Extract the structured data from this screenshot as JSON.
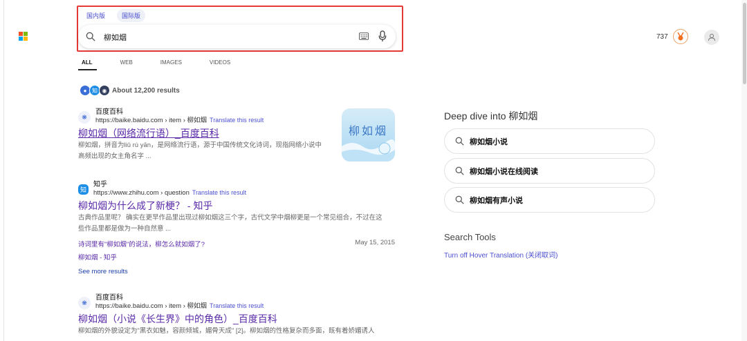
{
  "brand": {
    "logo_colors": [
      "#f25022",
      "#7fba00",
      "#00a4ef",
      "#ffb900"
    ]
  },
  "scope_tabs": [
    {
      "label": "国内版"
    },
    {
      "label": "国际版"
    }
  ],
  "search": {
    "query": "柳如烟"
  },
  "header": {
    "points": "737"
  },
  "nav_tabs": [
    {
      "label": "ALL"
    },
    {
      "label": "WEB"
    },
    {
      "label": "IMAGES"
    },
    {
      "label": "VIDEOS"
    }
  ],
  "results_count": "About 12,200 results",
  "results": [
    {
      "site_name": "百度百科",
      "url": "https://baike.baidu.com › item › 柳如烟",
      "translate": "Translate this result",
      "title": "柳如烟（网络流行语）_百度百科",
      "snippet_line1": "柳如烟，拼音为liǔ rú yān，是网络流行语，源于中国传统文化诗词，现指网络小说中",
      "snippet_line2": "高频出现的女主角名字 ..."
    },
    {
      "site_name": "知乎",
      "url": "https://www.zhihu.com › question",
      "translate": "Translate this result",
      "title": "柳如烟为什么成了新梗？ - 知乎",
      "snippet_line1": "古典作品里呢？ 确实在更早作品里出现过柳如烟这三个字，古代文学中烟柳更是一个常见组合，不过在这",
      "snippet_line2": "些作品里都是做为一种自然意 ...",
      "sublink1": "诗词里有\"柳如烟\"的说法，柳怎么就如烟了?",
      "sublink1_date": "May 15, 2015",
      "sublink2": "柳如烟 - 知乎",
      "more": "See more results"
    },
    {
      "site_name": "百度百科",
      "url": "https://baike.baidu.com › item › 柳如烟",
      "translate": "Translate this result",
      "title": "柳如烟（小说《长生界》中的角色）_百度百科",
      "snippet_line1": "柳如烟的外貌设定为\"黑衣如魅，容颜倾城，媚骨天成\" [2]。柳如烟的性格复杂而多面，既有着娇媚诱人"
    }
  ],
  "thumbnail": {
    "text": "柳如烟"
  },
  "deep_dive": {
    "title": "Deep dive into 柳如烟",
    "items": [
      {
        "label": "柳如烟小说"
      },
      {
        "label": "柳如烟小说在线阅读"
      },
      {
        "label": "柳如烟有声小说"
      }
    ]
  },
  "search_tools": {
    "title": "Search Tools",
    "link": "Turn off Hover Translation (关闭取词)"
  }
}
